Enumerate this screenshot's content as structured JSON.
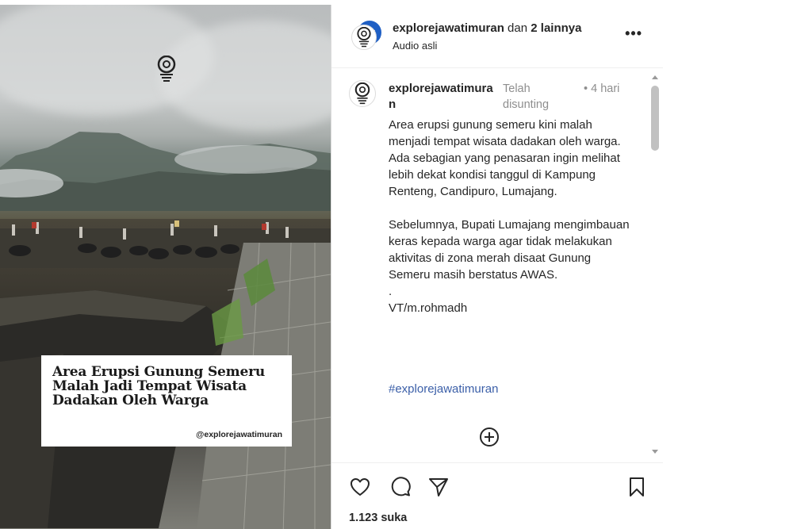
{
  "media": {
    "caption_title_line1": "Area Erupsi Gunung Semeru",
    "caption_title_line2": "Malah Jadi Tempat Wisata",
    "caption_title_line3": "Dadakan Oleh Warga",
    "caption_handle": "@explorejawatimuran"
  },
  "header": {
    "username": "explorejawatimuran",
    "others": " dan ",
    "others_count": "2 lainnya",
    "audio": "Audio asli",
    "more_icon": "more-horizontal-icon"
  },
  "post": {
    "username": "explorejawatimuran",
    "edited_label": "Telah disunting",
    "time": "• 4 hari",
    "paragraph1": "Area erupsi gunung semeru kini malah menjadi tempat wisata dadakan oleh warga. Ada sebagian yang penasaran ingin melihat lebih dekat kondisi tanggul di Kampung Renteng, Candipuro, Lumajang.",
    "paragraph2": "Sebelumnya, Bupati Lumajang mengimbauan keras kepada warga agar tidak melakukan aktivitas di zona merah disaat Gunung Semeru masih berstatus AWAS.",
    "dot": ".",
    "credit": "VT/m.rohmadh",
    "hashtag": "#explorejawatimuran",
    "add_icon": "plus-circle-icon"
  },
  "actions": {
    "like_icon": "heart-icon",
    "comment_icon": "comment-icon",
    "share_icon": "send-icon",
    "save_icon": "bookmark-icon",
    "likes": "1.123 suka"
  },
  "colors": {
    "hashtag": "#3b5fa8",
    "muted": "#8e8e8e",
    "text": "#262626"
  }
}
